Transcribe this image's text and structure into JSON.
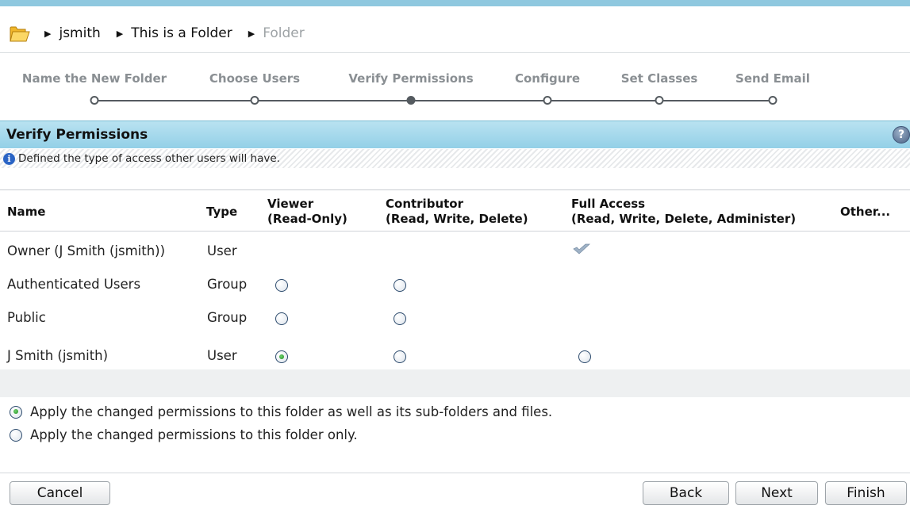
{
  "breadcrumb": {
    "items": [
      "jsmith",
      "This is a Folder",
      "Folder"
    ]
  },
  "wizard": {
    "steps": [
      {
        "label": "Name the New Folder",
        "active": false
      },
      {
        "label": "Choose Users",
        "active": false
      },
      {
        "label": "Verify Permissions",
        "active": true
      },
      {
        "label": "Configure",
        "active": false
      },
      {
        "label": "Set Classes",
        "active": false
      },
      {
        "label": "Send Email",
        "active": false
      }
    ]
  },
  "section": {
    "title": "Verify Permissions",
    "help_symbol": "?",
    "info_text": "Defined the type of access other users will have."
  },
  "table": {
    "headers": {
      "name": "Name",
      "type": "Type",
      "viewer_line1": "Viewer",
      "viewer_line2": "(Read-Only)",
      "contributor_line1": "Contributor",
      "contributor_line2": "(Read, Write, Delete)",
      "full_line1": "Full Access",
      "full_line2": "(Read, Write, Delete, Administer)",
      "other": "Other..."
    },
    "rows": [
      {
        "name": "Owner (J Smith (jsmith))",
        "type": "User",
        "viewer": "none",
        "contributor": "none",
        "full": "fixed-check"
      },
      {
        "name": "Authenticated Users",
        "type": "Group",
        "viewer": "unchecked",
        "contributor": "unchecked",
        "full": "none"
      },
      {
        "name": "Public",
        "type": "Group",
        "viewer": "unchecked",
        "contributor": "unchecked",
        "full": "none"
      },
      {
        "name": "J Smith (jsmith)",
        "type": "User",
        "viewer": "checked",
        "contributor": "unchecked",
        "full": "unchecked"
      }
    ]
  },
  "scope": {
    "options": [
      {
        "label": "Apply the changed permissions to this folder as well as its sub-folders and files.",
        "checked": true
      },
      {
        "label": "Apply the changed permissions to this folder only.",
        "checked": false
      }
    ]
  },
  "buttons": {
    "cancel": "Cancel",
    "back": "Back",
    "next": "Next",
    "finish": "Finish"
  },
  "icons": {
    "folder": "open-folder-icon",
    "separator": "triangle-right-icon",
    "help": "help-icon",
    "info": "info-icon",
    "check": "checkmark-icon"
  },
  "colors": {
    "header_band": "#93d0e7",
    "top_strip": "#8fc8df",
    "step_line": "#555b60",
    "step_text": "#8a8f93",
    "radio_selected": "#1f8d1f"
  }
}
